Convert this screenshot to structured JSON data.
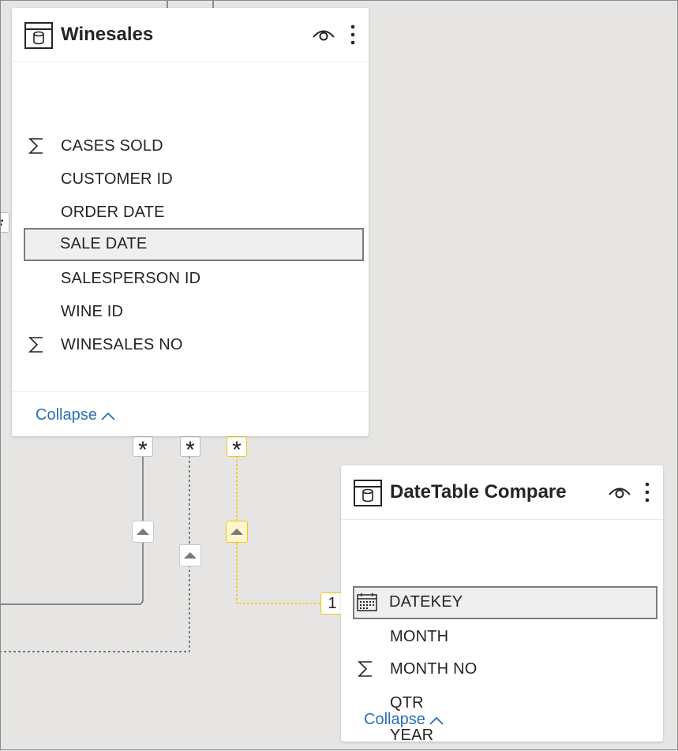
{
  "tables": [
    {
      "title": "Winesales",
      "fields": [
        {
          "name": "CASES SOLD",
          "icon": "sigma-icon"
        },
        {
          "name": "CUSTOMER ID",
          "icon": ""
        },
        {
          "name": "ORDER DATE",
          "icon": ""
        },
        {
          "name": "SALE DATE",
          "icon": "",
          "selected": true
        },
        {
          "name": "SALESPERSON ID",
          "icon": ""
        },
        {
          "name": "WINE ID",
          "icon": ""
        },
        {
          "name": "WINESALES NO",
          "icon": "sigma-icon"
        }
      ],
      "collapse_label": "Collapse"
    },
    {
      "title": "DateTable Compare",
      "fields": [
        {
          "name": "DATEKEY",
          "icon": "calendar-icon",
          "selected": true
        },
        {
          "name": "MONTH",
          "icon": ""
        },
        {
          "name": "MONTH NO",
          "icon": "sigma-icon"
        },
        {
          "name": "QTR",
          "icon": ""
        },
        {
          "name": "YEAR",
          "icon": ""
        }
      ],
      "collapse_label": "Collapse"
    }
  ],
  "relationships": {
    "many_symbol": "*",
    "one_symbol": "1",
    "active_color": "#f2c811",
    "inactive_color": "#666666"
  },
  "colors": {
    "canvas": "#e6e5e4",
    "link": "#2a6fb5",
    "selected_border": "#7b7b7b"
  }
}
